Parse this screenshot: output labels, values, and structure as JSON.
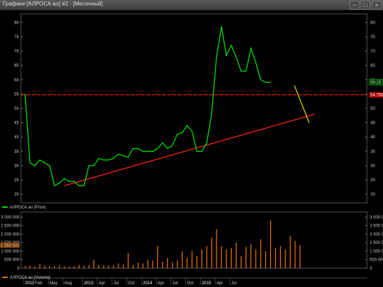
{
  "window": {
    "title": "Графики [АЛРОСА ао] #2 - [Месячный]",
    "buttons": [
      "–",
      "□",
      "×"
    ]
  },
  "chart_data": [
    {
      "type": "line",
      "title": "",
      "legend": "АЛРОСА ао [Price]",
      "xlabel": "",
      "ylabel": "",
      "ylim": [
        17,
        83
      ],
      "yticks": [
        20,
        25,
        30,
        35,
        40,
        45,
        50,
        55,
        60,
        65,
        70,
        75,
        80
      ],
      "series": [
        {
          "name": "АЛРОСА ао [Price]",
          "color": "#00e000",
          "x": [
            "2011-01",
            "2011-02",
            "2011-03",
            "2011-04",
            "2011-05",
            "2011-06",
            "2011-07",
            "2011-08",
            "2011-09",
            "2011-10",
            "2011-11",
            "2011-12",
            "2012-01",
            "2012-02",
            "2012-03",
            "2012-04",
            "2012-05",
            "2012-06",
            "2012-07",
            "2012-08",
            "2012-09",
            "2012-10",
            "2012-11",
            "2012-12",
            "2013-01",
            "2013-02",
            "2013-03",
            "2013-04",
            "2013-05",
            "2013-06",
            "2013-07",
            "2013-08",
            "2013-09",
            "2013-10",
            "2013-11",
            "2013-12",
            "2014-01",
            "2014-02",
            "2014-03",
            "2014-04",
            "2014-05",
            "2014-06",
            "2014-07",
            "2014-08",
            "2014-09",
            "2014-10",
            "2014-11",
            "2014-12",
            "2015-01",
            "2015-02",
            "2015-03",
            "2015-04",
            "2015-05",
            "2015-06",
            "2015-07",
            "2015-08",
            "2015-09"
          ],
          "values": [
            55,
            31,
            30,
            32,
            31,
            30,
            23,
            24,
            25.5,
            24.5,
            24.5,
            23,
            23,
            30,
            30,
            32.5,
            32,
            32,
            32.5,
            34,
            33.5,
            33,
            36,
            36,
            35,
            35,
            35,
            36,
            38,
            36,
            37,
            41,
            41.5,
            44,
            42,
            35,
            35,
            38,
            48,
            68,
            78.5,
            68.5,
            72,
            68,
            63,
            63,
            71,
            66,
            60,
            59.15,
            59,
            59,
            59,
            59,
            59,
            59,
            59
          ]
        }
      ],
      "annotations": {
        "last_price_label": "59.15",
        "level_label": "54.750",
        "horizontal_level": 54.75,
        "trendline": {
          "color": "#ff2020",
          "from": [
            "2011-09",
            23
          ],
          "to": [
            "2015-12",
            48
          ]
        },
        "projection": {
          "color": "#e0d000",
          "from": [
            "2015-09",
            58
          ],
          "to": [
            "2015-12",
            45
          ]
        }
      },
      "grid": false
    },
    {
      "type": "bar",
      "title": "",
      "legend": "АЛРОСА ао [Volume]",
      "ylim": [
        0,
        3300000
      ],
      "yticks": [
        0,
        500000,
        1000000,
        1500000,
        2000000,
        2500000,
        3000000
      ],
      "ytick_labels": [
        "0",
        "500 000",
        "1 000 000",
        "1 500 000",
        "2 000 000",
        "2 500 000",
        "3 000 000"
      ],
      "last_volume_label": "1 350 000",
      "series": [
        {
          "name": "АЛРОСА ао [Volume]",
          "color": "#e07000",
          "values": [
            120000,
            150000,
            100000,
            250000,
            160000,
            120000,
            130000,
            180000,
            100000,
            90000,
            120000,
            200000,
            150000,
            180000,
            500000,
            200000,
            170000,
            160000,
            170000,
            280000,
            220000,
            900000,
            180000,
            350000,
            280000,
            500000,
            450000,
            1300000,
            380000,
            600000,
            380000,
            450000,
            1000000,
            600000,
            1000000,
            700000,
            1100000,
            1300000,
            1800000,
            2300000,
            1300000,
            1100000,
            1200000,
            1500000,
            700000,
            1250000,
            1400000,
            1100000,
            1700000,
            1000000,
            2800000,
            1200000,
            1300000,
            1100000,
            1900000,
            1600000,
            1350000
          ]
        }
      ],
      "x_axis_labels": [
        {
          "label": "2011",
          "month": 0,
          "highlight": true
        },
        {
          "label": "Feb",
          "month": 2
        },
        {
          "label": "May",
          "month": 5
        },
        {
          "label": "Aug",
          "month": 8
        },
        {
          "label": "2013",
          "month": 12,
          "highlight": true
        },
        {
          "label": "Apr",
          "month": 15
        },
        {
          "label": "Jul",
          "month": 18
        },
        {
          "label": "Oct",
          "month": 21
        },
        {
          "label": "2014",
          "month": 24,
          "highlight": true
        },
        {
          "label": "Apr",
          "month": 27
        },
        {
          "label": "Jul",
          "month": 30
        },
        {
          "label": "Oct",
          "month": 33
        },
        {
          "label": "2015",
          "month": 36,
          "highlight": true
        },
        {
          "label": "Apr",
          "month": 39
        },
        {
          "label": "Jul",
          "month": 42
        }
      ]
    }
  ]
}
